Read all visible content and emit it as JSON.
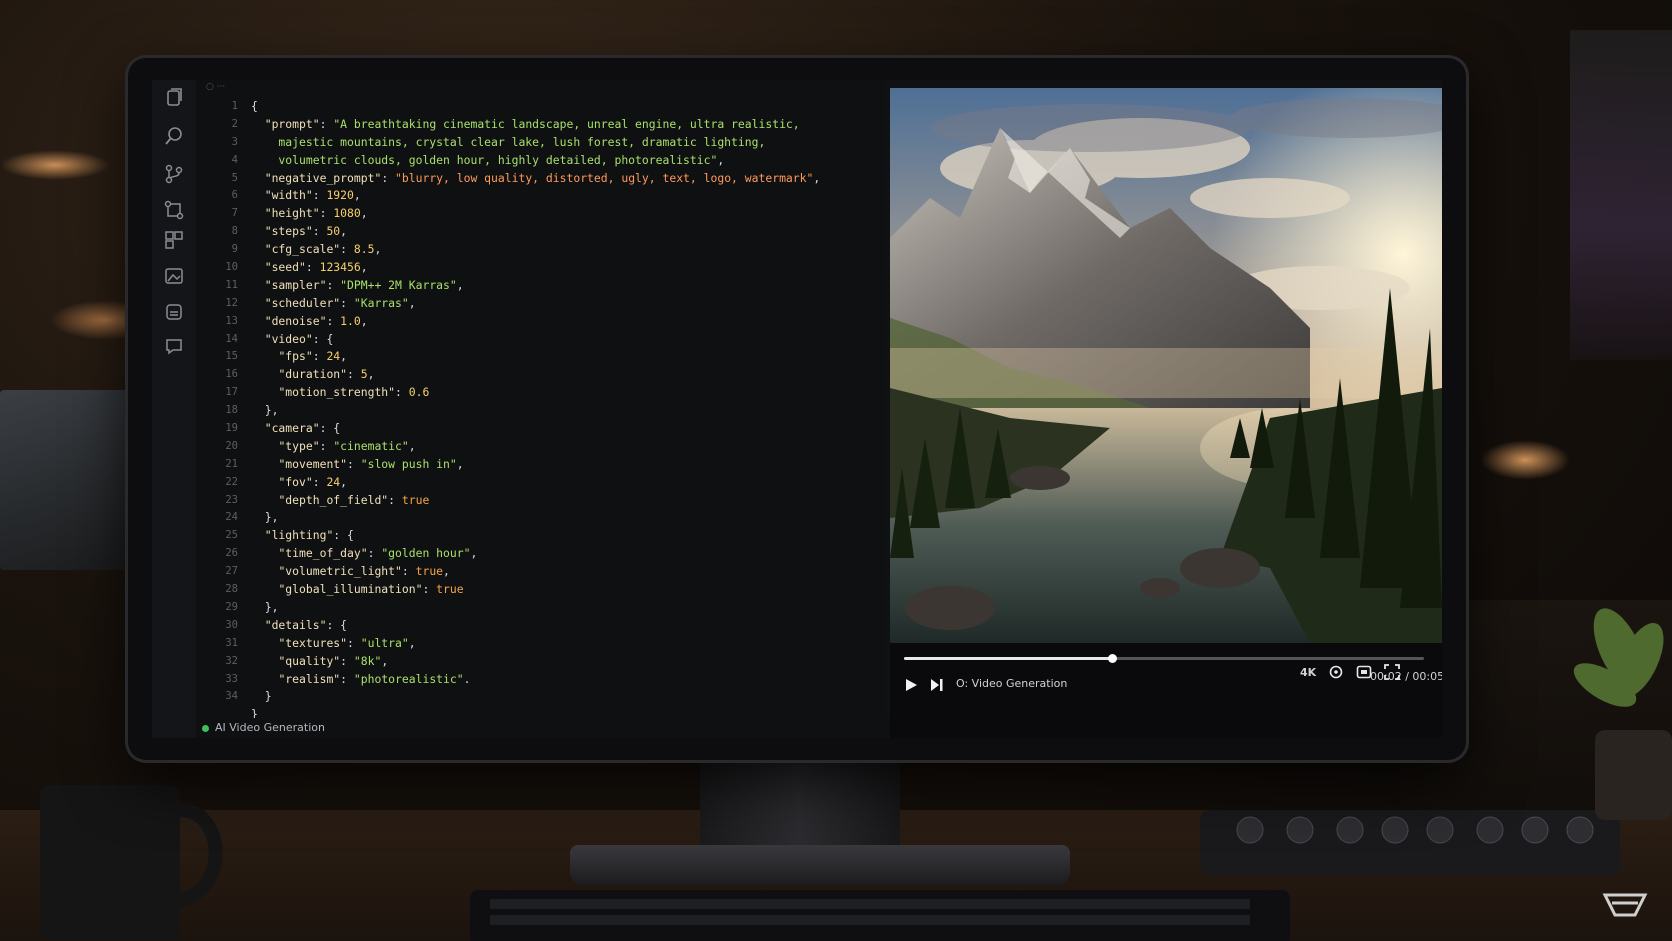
{
  "editor": {
    "tab_label": "○ ···",
    "status_label": "AI Video Generation",
    "line_numbers": [
      "1",
      "2",
      "3",
      "4",
      "5",
      "6",
      "7",
      "8",
      "9",
      "10",
      "11",
      "12",
      "13",
      "14",
      "15",
      "16",
      "17",
      "18",
      "19",
      "20",
      "21",
      "22",
      "23",
      "24",
      "25",
      "26",
      "27",
      "28",
      "29",
      "30",
      "31",
      "32",
      "33",
      "34"
    ],
    "code_lines": [
      [
        [
          "p",
          "{"
        ]
      ],
      [
        [
          "p",
          "  "
        ],
        [
          "k",
          "\"prompt\""
        ],
        [
          "p",
          ": "
        ],
        [
          "s",
          "\"A breathtaking cinematic landscape, unreal engine, ultra realistic,"
        ]
      ],
      [
        [
          "s",
          "    majestic mountains, crystal clear lake, lush forest, dramatic lighting,"
        ]
      ],
      [
        [
          "s",
          "    volumetric clouds, golden hour, highly detailed, photorealistic\""
        ],
        [
          "p",
          ","
        ]
      ],
      [
        [
          "p",
          "  "
        ],
        [
          "k",
          "\"negative_prompt\""
        ],
        [
          "p",
          ": "
        ],
        [
          "neg",
          "\"blurry, low quality, distorted, ugly, text, logo, watermark\""
        ],
        [
          "p",
          ","
        ]
      ],
      [
        [
          "p",
          "  "
        ],
        [
          "k",
          "\"width\""
        ],
        [
          "p",
          ": "
        ],
        [
          "n",
          "1920"
        ],
        [
          "p",
          ","
        ]
      ],
      [
        [
          "p",
          "  "
        ],
        [
          "k",
          "\"height\""
        ],
        [
          "p",
          ": "
        ],
        [
          "n",
          "1080"
        ],
        [
          "p",
          ","
        ]
      ],
      [
        [
          "p",
          "  "
        ],
        [
          "k",
          "\"steps\""
        ],
        [
          "p",
          ": "
        ],
        [
          "n",
          "50"
        ],
        [
          "p",
          ","
        ]
      ],
      [
        [
          "p",
          "  "
        ],
        [
          "k",
          "\"cfg_scale\""
        ],
        [
          "p",
          ": "
        ],
        [
          "n",
          "8.5"
        ],
        [
          "p",
          ","
        ]
      ],
      [
        [
          "p",
          "  "
        ],
        [
          "k",
          "\"seed\""
        ],
        [
          "p",
          ": "
        ],
        [
          "n",
          "123456"
        ],
        [
          "p",
          ","
        ]
      ],
      [
        [
          "p",
          "  "
        ],
        [
          "k",
          "\"sampler\""
        ],
        [
          "p",
          ": "
        ],
        [
          "s",
          "\"DPM++ 2M Karras\""
        ],
        [
          "p",
          ","
        ]
      ],
      [
        [
          "p",
          "  "
        ],
        [
          "k",
          "\"scheduler\""
        ],
        [
          "p",
          ": "
        ],
        [
          "s",
          "\"Karras\""
        ],
        [
          "p",
          ","
        ]
      ],
      [
        [
          "p",
          "  "
        ],
        [
          "k",
          "\"denoise\""
        ],
        [
          "p",
          ": "
        ],
        [
          "n",
          "1.0"
        ],
        [
          "p",
          ","
        ]
      ],
      [
        [
          "p",
          "  "
        ],
        [
          "k",
          "\"video\""
        ],
        [
          "p",
          ": {"
        ]
      ],
      [
        [
          "p",
          "    "
        ],
        [
          "k",
          "\"fps\""
        ],
        [
          "p",
          ": "
        ],
        [
          "n",
          "24"
        ],
        [
          "p",
          ","
        ]
      ],
      [
        [
          "p",
          "    "
        ],
        [
          "k",
          "\"duration\""
        ],
        [
          "p",
          ": "
        ],
        [
          "n",
          "5"
        ],
        [
          "p",
          ","
        ]
      ],
      [
        [
          "p",
          "    "
        ],
        [
          "k",
          "\"motion_strength\""
        ],
        [
          "p",
          ": "
        ],
        [
          "n",
          "0.6"
        ]
      ],
      [
        [
          "p",
          "  },"
        ]
      ],
      [
        [
          "p",
          "  "
        ],
        [
          "k",
          "\"camera\""
        ],
        [
          "p",
          ": {"
        ]
      ],
      [
        [
          "p",
          "    "
        ],
        [
          "k",
          "\"type\""
        ],
        [
          "p",
          ": "
        ],
        [
          "s",
          "\"cinematic\""
        ],
        [
          "p",
          ","
        ]
      ],
      [
        [
          "p",
          "    "
        ],
        [
          "k",
          "\"movement\""
        ],
        [
          "p",
          ": "
        ],
        [
          "s",
          "\"slow push in\""
        ],
        [
          "p",
          ","
        ]
      ],
      [
        [
          "p",
          "    "
        ],
        [
          "k",
          "\"fov\""
        ],
        [
          "p",
          ": "
        ],
        [
          "n",
          "24"
        ],
        [
          "p",
          ","
        ]
      ],
      [
        [
          "p",
          "    "
        ],
        [
          "k",
          "\"depth_of_field\""
        ],
        [
          "p",
          ": "
        ],
        [
          "b",
          "true"
        ]
      ],
      [
        [
          "p",
          "  },"
        ]
      ],
      [
        [
          "p",
          "  "
        ],
        [
          "k",
          "\"lighting\""
        ],
        [
          "p",
          ": {"
        ]
      ],
      [
        [
          "p",
          "    "
        ],
        [
          "k",
          "\"time_of_day\""
        ],
        [
          "p",
          ": "
        ],
        [
          "s",
          "\"golden hour\""
        ],
        [
          "p",
          ","
        ]
      ],
      [
        [
          "p",
          "    "
        ],
        [
          "k",
          "\"volumetric_light\""
        ],
        [
          "p",
          ": "
        ],
        [
          "b",
          "true"
        ],
        [
          "p",
          ","
        ]
      ],
      [
        [
          "p",
          "    "
        ],
        [
          "k",
          "\"global_illumination\""
        ],
        [
          "p",
          ": "
        ],
        [
          "b",
          "true"
        ]
      ],
      [
        [
          "p",
          "  },"
        ]
      ],
      [
        [
          "p",
          "  "
        ],
        [
          "k",
          "\"details\""
        ],
        [
          "p",
          ": {"
        ]
      ],
      [
        [
          "p",
          "    "
        ],
        [
          "k",
          "\"textures\""
        ],
        [
          "p",
          ": "
        ],
        [
          "s",
          "\"ultra\""
        ],
        [
          "p",
          ","
        ]
      ],
      [
        [
          "p",
          "    "
        ],
        [
          "k",
          "\"quality\""
        ],
        [
          "p",
          ": "
        ],
        [
          "s",
          "\"8k\""
        ],
        [
          "p",
          ","
        ]
      ],
      [
        [
          "p",
          "    "
        ],
        [
          "k",
          "\"realism\""
        ],
        [
          "p",
          ": "
        ],
        [
          "s",
          "\"photorealistic\""
        ],
        [
          "p",
          "."
        ]
      ],
      [
        [
          "p",
          "  }"
        ]
      ],
      [
        [
          "p",
          "}"
        ]
      ]
    ]
  },
  "activity_icons": [
    "files-icon",
    "search-icon",
    "source-control-icon",
    "run-debug-icon",
    "extensions-icon",
    "image-gen-icon",
    "settings-icon",
    "comments-icon"
  ],
  "video_player": {
    "title": "O: Video Generation",
    "time": "00:02 / 00:05",
    "quality_badge": "4K",
    "progress": 0.4
  }
}
